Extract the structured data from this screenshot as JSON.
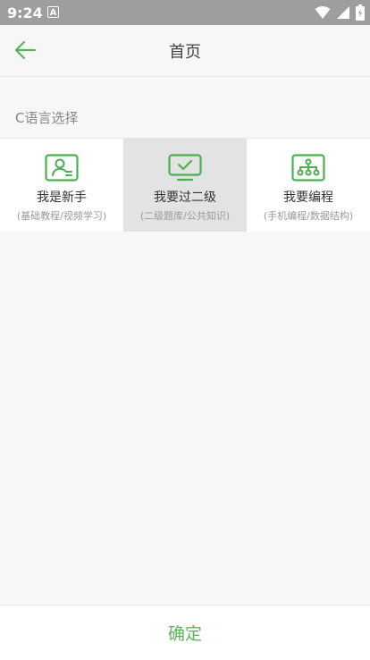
{
  "status": {
    "time": "9:24",
    "app_indicator": "A"
  },
  "appbar": {
    "title": "首页",
    "back_icon": "arrow-left-icon"
  },
  "section": {
    "label": "C语言选择"
  },
  "options": [
    {
      "title": "我是新手",
      "subtitle": "(基础教程/视频学习)",
      "icon": "person-card-icon",
      "selected": false
    },
    {
      "title": "我要过二级",
      "subtitle": "(二级题库/公共知识)",
      "icon": "monitor-check-icon",
      "selected": true
    },
    {
      "title": "我要编程",
      "subtitle": "(手机编程/数据结构)",
      "icon": "network-icon",
      "selected": false
    }
  ],
  "bottom": {
    "confirm_label": "确定"
  },
  "colors": {
    "accent": "#5bb65b",
    "statusbar": "#9e9e9e",
    "selected_bg": "#e3e3e3"
  }
}
